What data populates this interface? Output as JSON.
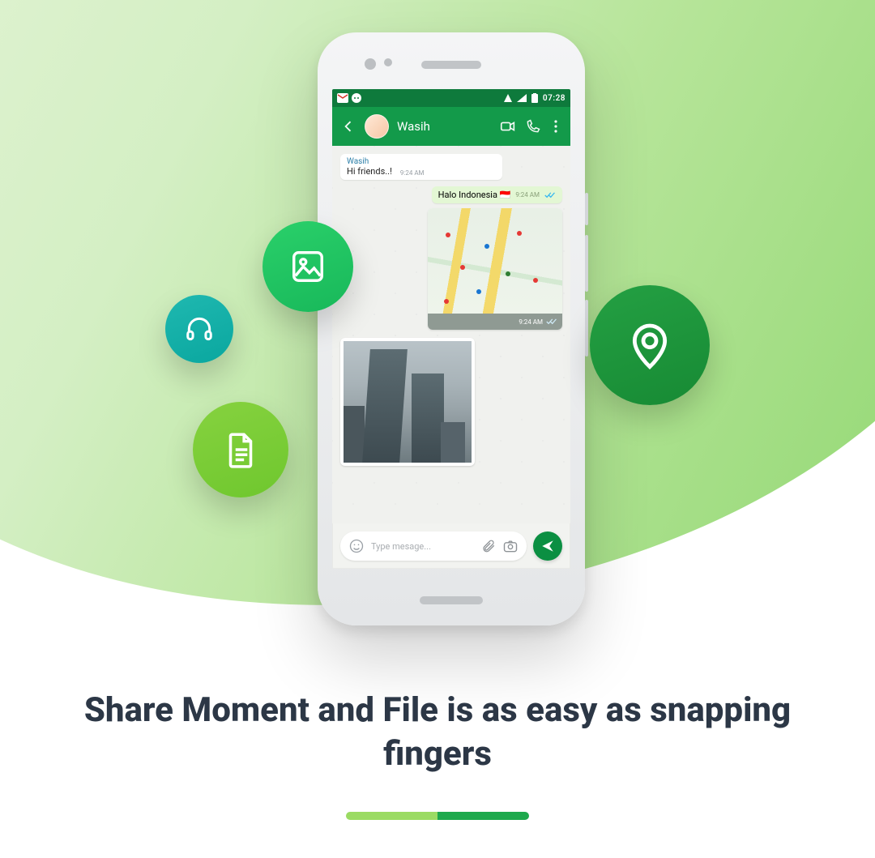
{
  "headline": "Share Moment and File is as easy as snapping fingers",
  "statusbar": {
    "time": "07:28"
  },
  "chat": {
    "contact_name": "Wasih",
    "messages": {
      "incoming": {
        "sender": "Wasih",
        "text": "Hi friends..!",
        "time": "9:24 AM"
      },
      "outgoing_text": {
        "text": "Halo Indonesia 🇮🇩",
        "time": "9:24 AM"
      },
      "location": {
        "time": "9:24 AM"
      }
    },
    "input_placeholder": "Type mesage..."
  },
  "share_buttons": {
    "image": "image-icon",
    "audio": "headphones-icon",
    "document": "document-icon",
    "location": "location-pin-icon"
  },
  "colors": {
    "brand_green": "#139a4a",
    "dark_green": "#0e7a3c",
    "send_green": "#0b8f42",
    "headline": "#2c3746"
  }
}
